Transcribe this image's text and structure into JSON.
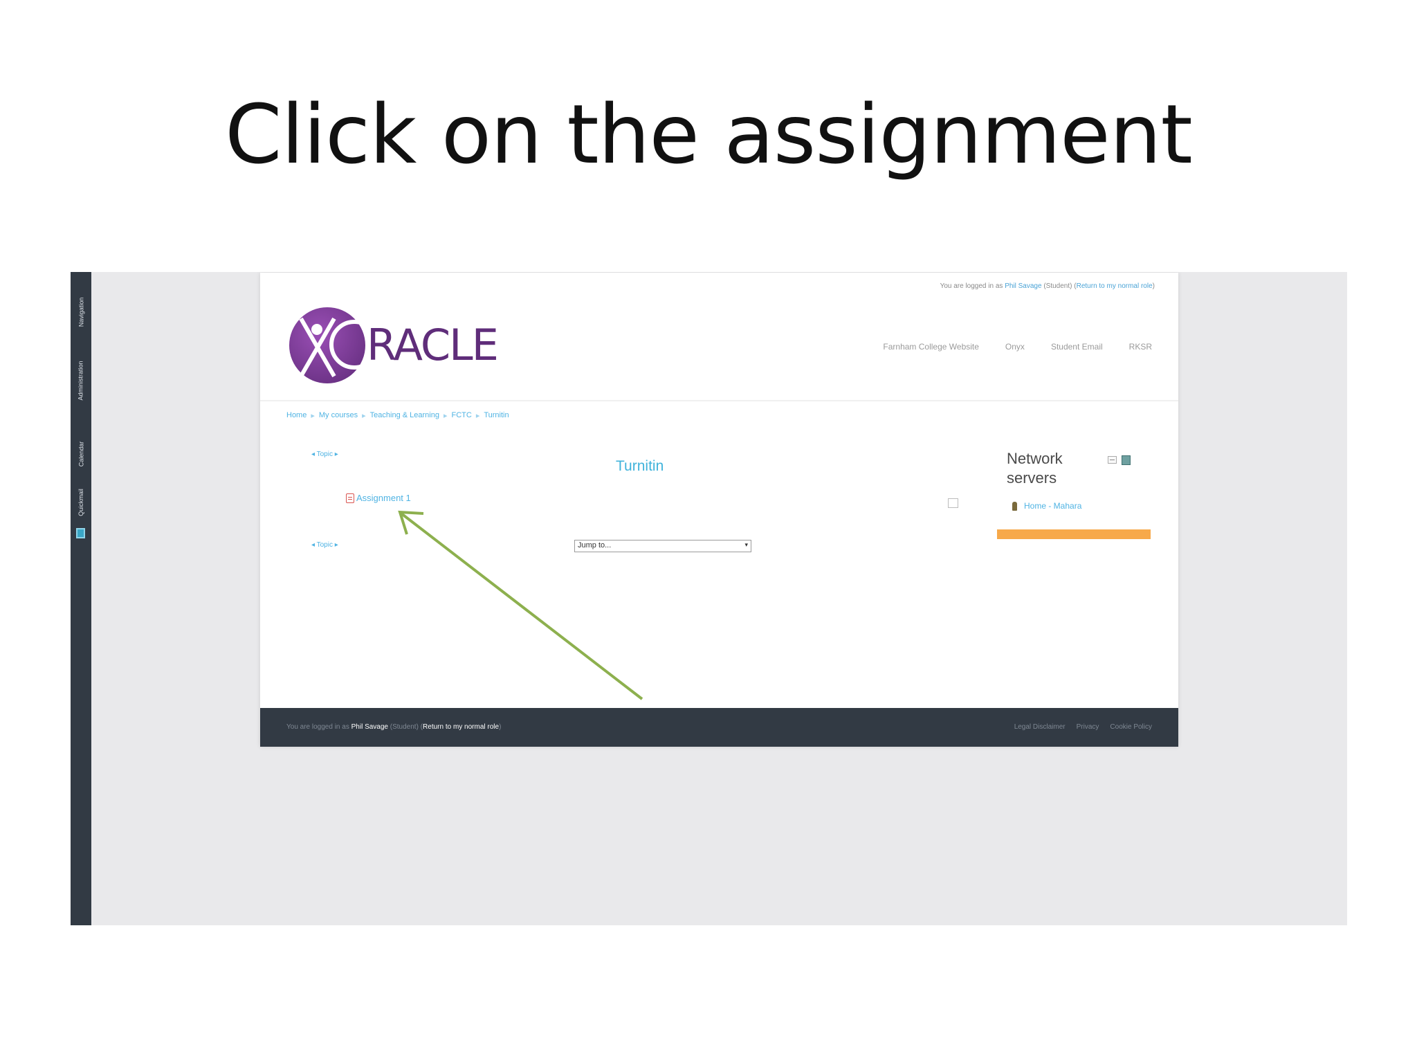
{
  "slide": {
    "title": "Click on the assignment"
  },
  "dock": {
    "tabs": [
      "Navigation",
      "Administration",
      "Calendar",
      "Quickmail"
    ]
  },
  "header": {
    "login_prefix": "You are logged in as",
    "login_user": "Phil Savage",
    "login_role": "Student",
    "login_return": "Return to my normal role",
    "logo_text": "RACLE",
    "nav": [
      "Farnham College Website",
      "Onyx",
      "Student Email",
      "RKSR"
    ]
  },
  "breadcrumb": [
    "Home",
    "My courses",
    "Teaching & Learning",
    "FCTC",
    "Turnitin"
  ],
  "course": {
    "topic_prev": "◂ Topic ▸",
    "topic_next": "◂ Topic ▸",
    "section_title": "Turnitin",
    "assignment_label": "Assignment 1",
    "jump_label": "Jump to...",
    "jump_caret": "▾"
  },
  "block": {
    "title": "Network servers",
    "item": "Home - Mahara"
  },
  "footer": {
    "prefix": "You are logged in as",
    "user": "Phil Savage",
    "role": "Student",
    "return": "Return to my normal role",
    "links": [
      "Legal Disclaimer",
      "Privacy",
      "Cookie Policy"
    ]
  },
  "colors": {
    "accent": "#40b3db",
    "brand": "#5f2d7a",
    "dock": "#323a44",
    "arrow": "#8db04e",
    "block_bar": "#f7a94a"
  }
}
